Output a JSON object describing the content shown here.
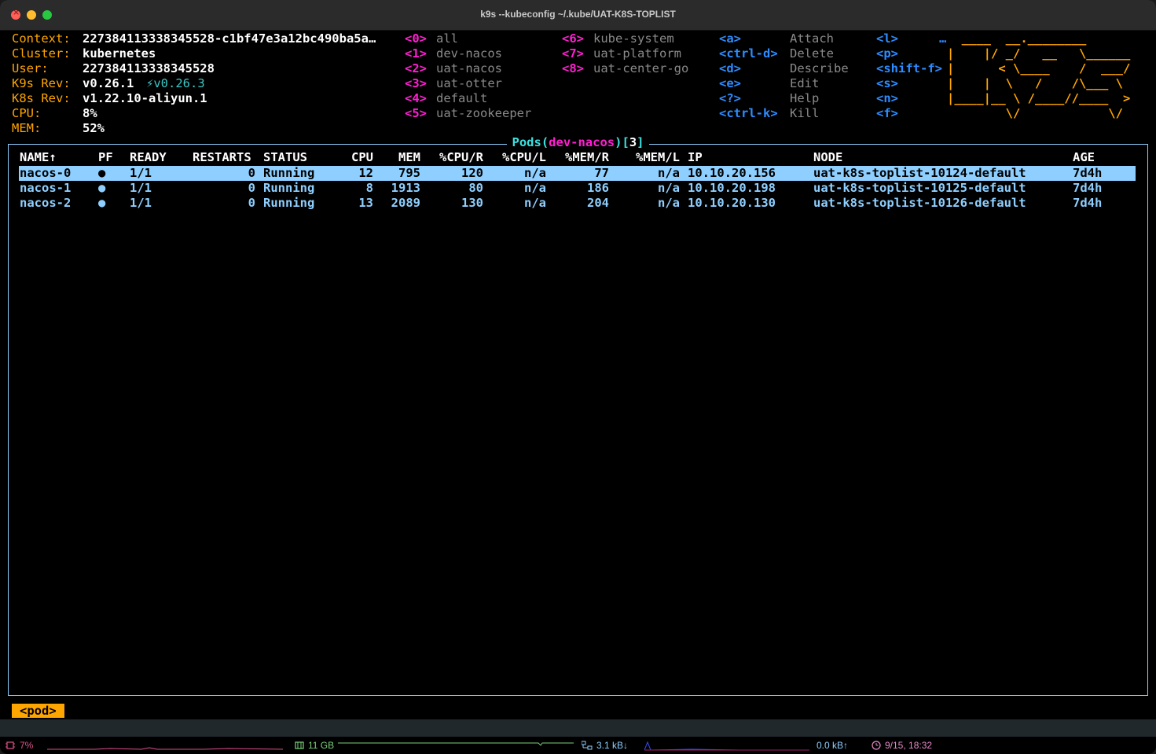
{
  "window": {
    "title": "k9s --kubeconfig ~/.kube/UAT-K8S-TOPLIST"
  },
  "info": {
    "context_label": "Context:",
    "context_value": "227384113338345528-c1bf47e3a12bc490ba5a…",
    "cluster_label": "Cluster:",
    "cluster_value": "kubernetes",
    "user_label": "User:",
    "user_value": "227384113338345528",
    "k9s_rev_label": "K9s Rev:",
    "k9s_rev_value": "v0.26.1",
    "k9s_rev_upgrade": "⚡v0.26.3",
    "k8s_rev_label": "K8s Rev:",
    "k8s_rev_value": "v1.22.10-aliyun.1",
    "cpu_label": "CPU:",
    "cpu_value": "8%",
    "mem_label": "MEM:",
    "mem_value": "52%"
  },
  "namespaces": [
    {
      "key": "<0>",
      "name": "all"
    },
    {
      "key": "<1>",
      "name": "dev-nacos"
    },
    {
      "key": "<2>",
      "name": "uat-nacos"
    },
    {
      "key": "<3>",
      "name": "uat-otter"
    },
    {
      "key": "<4>",
      "name": "default"
    },
    {
      "key": "<5>",
      "name": "uat-zookeeper"
    },
    {
      "key": "<6>",
      "name": "kube-system"
    },
    {
      "key": "<7>",
      "name": "uat-platform"
    },
    {
      "key": "<8>",
      "name": "uat-center-go"
    }
  ],
  "shortcuts": [
    {
      "key": "<a>",
      "action": "Attach"
    },
    {
      "key": "<ctrl-d>",
      "action": "Delete"
    },
    {
      "key": "<d>",
      "action": "Describe"
    },
    {
      "key": "<e>",
      "action": "Edit"
    },
    {
      "key": "<?>",
      "action": "Help"
    },
    {
      "key": "<ctrl-k>",
      "action": "Kill"
    }
  ],
  "shortcuts_extra": [
    "<l>",
    "<p>",
    "<shift-f>",
    "<s>",
    "<n>",
    "<f>"
  ],
  "logo": {
    "line1": "  ____  __.________",
    "line2": "|    |/ _/   __   \\______",
    "line3": "|      < \\____    /  ___/",
    "line4": "|    |  \\   /    /\\___ \\",
    "line5": "|____|__ \\ /____//____  >",
    "line6": "        \\/            \\/",
    "dots": "…"
  },
  "panel": {
    "resource": "Pods",
    "namespace": "dev-nacos",
    "count": "3"
  },
  "columns": {
    "name": "NAME↑",
    "pf": "PF",
    "ready": "READY",
    "restarts": "RESTARTS",
    "status": "STATUS",
    "cpu": "CPU",
    "mem": "MEM",
    "cpu_r": "%CPU/R",
    "cpu_l": "%CPU/L",
    "mem_r": "%MEM/R",
    "mem_l": "%MEM/L",
    "ip": "IP",
    "node": "NODE",
    "age": "AGE"
  },
  "pods": [
    {
      "name": "nacos-0",
      "pf": "●",
      "ready": "1/1",
      "restarts": "0",
      "status": "Running",
      "cpu": "12",
      "mem": "795",
      "cpu_r": "120",
      "cpu_l": "n/a",
      "mem_r": "77",
      "mem_l": "n/a",
      "ip": "10.10.20.156",
      "node": "uat-k8s-toplist-10124-default",
      "age": "7d4h"
    },
    {
      "name": "nacos-1",
      "pf": "●",
      "ready": "1/1",
      "restarts": "0",
      "status": "Running",
      "cpu": "8",
      "mem": "1913",
      "cpu_r": "80",
      "cpu_l": "n/a",
      "mem_r": "186",
      "mem_l": "n/a",
      "ip": "10.10.20.198",
      "node": "uat-k8s-toplist-10125-default",
      "age": "7d4h"
    },
    {
      "name": "nacos-2",
      "pf": "●",
      "ready": "1/1",
      "restarts": "0",
      "status": "Running",
      "cpu": "13",
      "mem": "2089",
      "cpu_r": "130",
      "cpu_l": "n/a",
      "mem_r": "204",
      "mem_l": "n/a",
      "ip": "10.10.20.130",
      "node": "uat-k8s-toplist-10126-default",
      "age": "7d4h"
    }
  ],
  "crumb": "<pod>",
  "statusbar": {
    "cpu": "7%",
    "memory": "11 GB",
    "network_down": "3.1 kB↓",
    "network_up": "0.0 kB↑",
    "clock": "9/15, 18:32",
    "colors": {
      "cpu": "#e0508a",
      "memory": "#7bd07b",
      "network": "#8ecfff",
      "clock": "#e58ac9"
    }
  }
}
